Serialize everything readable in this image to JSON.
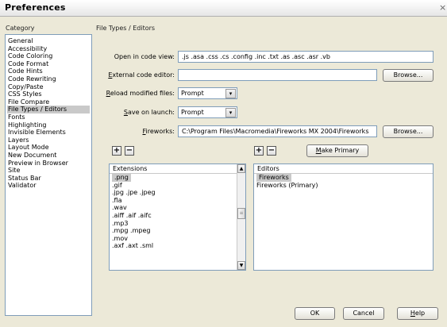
{
  "window": {
    "title": "Preferences"
  },
  "category": {
    "heading": "Category",
    "items": [
      {
        "label": "General"
      },
      {
        "label": "Accessibility"
      },
      {
        "label": "Code Coloring"
      },
      {
        "label": "Code Format"
      },
      {
        "label": "Code Hints"
      },
      {
        "label": "Code Rewriting"
      },
      {
        "label": "Copy/Paste"
      },
      {
        "label": "CSS Styles"
      },
      {
        "label": "File Compare"
      },
      {
        "label": "File Types / Editors",
        "selected": true
      },
      {
        "label": "Fonts"
      },
      {
        "label": "Highlighting"
      },
      {
        "label": "Invisible Elements"
      },
      {
        "label": "Layers"
      },
      {
        "label": "Layout Mode"
      },
      {
        "label": "New Document"
      },
      {
        "label": "Preview in Browser"
      },
      {
        "label": "Site"
      },
      {
        "label": "Status Bar"
      },
      {
        "label": "Validator"
      }
    ]
  },
  "panel": {
    "heading": "File Types / Editors",
    "open_in_code_view": {
      "label": "Open in code view:",
      "value": ".js .asa .css .cs .config .inc .txt .as .asc .asr .vb"
    },
    "external_code_editor": {
      "label_pre": "",
      "label_key": "E",
      "label_post": "xternal code editor:",
      "value": "",
      "browse": "Browse..."
    },
    "reload_modified": {
      "label_key": "R",
      "label_post": "eload modified files:",
      "value": "Prompt"
    },
    "save_on_launch": {
      "label_key": "S",
      "label_post": "ave on launch:",
      "value": "Prompt"
    },
    "fireworks": {
      "label_key": "F",
      "label_post": "ireworks:",
      "value": "C:\\Program Files\\Macromedia\\Fireworks MX 2004\\Fireworks",
      "browse": "Browse..."
    },
    "make_primary": {
      "label_key": "M",
      "label_post": "ake Primary"
    },
    "extensions": {
      "heading": "Extensions",
      "items": [
        {
          "label": ".png",
          "selected": true
        },
        {
          "label": ".gif"
        },
        {
          "label": ".jpg .jpe .jpeg"
        },
        {
          "label": ".fla"
        },
        {
          "label": ".wav"
        },
        {
          "label": ".aiff .aif .aifc"
        },
        {
          "label": ".mp3"
        },
        {
          "label": ".mpg .mpeg"
        },
        {
          "label": ".mov"
        },
        {
          "label": ".axf .axt .sml"
        }
      ]
    },
    "editors": {
      "heading": "Editors",
      "items": [
        {
          "label": "Fireworks",
          "selected": true
        },
        {
          "label": "Fireworks (Primary)"
        }
      ]
    },
    "plus_glyph": "+",
    "minus_glyph": "−",
    "dropdown_glyph": "▾",
    "scroll_up_glyph": "▲",
    "scroll_down_glyph": "▼",
    "thumb_glyph": "≡"
  },
  "footer": {
    "ok": "OK",
    "cancel": "Cancel",
    "help_key": "H",
    "help_post": "elp"
  }
}
